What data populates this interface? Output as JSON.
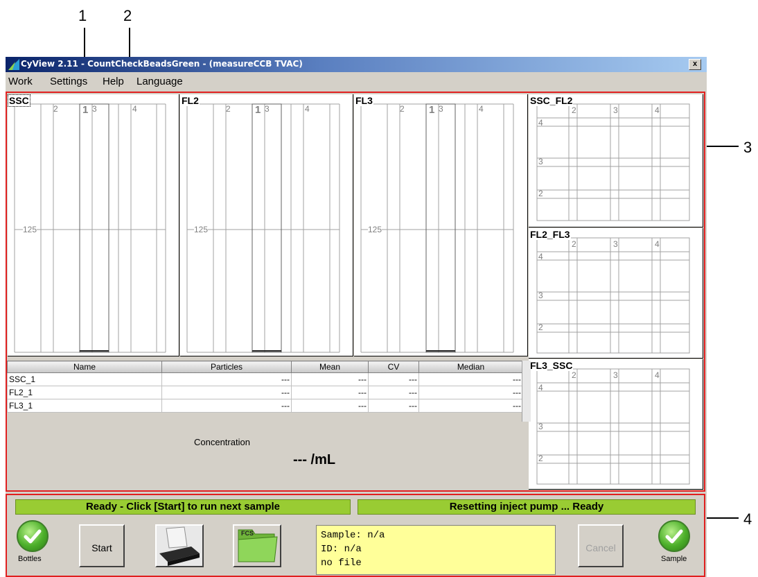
{
  "callouts": [
    "1",
    "2",
    "3",
    "4"
  ],
  "window": {
    "title": "CyView 2.11 - CountCheckBeadsGreen - (measureCCB TVAC)",
    "close_label": "x"
  },
  "menu": [
    {
      "label": "Work"
    },
    {
      "label": "Settings"
    },
    {
      "label": "Help"
    },
    {
      "label": "Language"
    }
  ],
  "histograms": [
    {
      "name": "SSC",
      "marker": "1",
      "ticks": [
        "2",
        "3",
        "4"
      ],
      "y_tick": "125"
    },
    {
      "name": "FL2",
      "marker": "1",
      "ticks": [
        "2",
        "3",
        "4"
      ],
      "y_tick": "125"
    },
    {
      "name": "FL3",
      "marker": "1",
      "ticks": [
        "2",
        "3",
        "4"
      ],
      "y_tick": "125"
    }
  ],
  "scatterplots": [
    {
      "name": "SSC_FL2",
      "x_ticks": [
        "2",
        "3",
        "4"
      ],
      "y_ticks": [
        "4",
        "3",
        "2"
      ]
    },
    {
      "name": "FL2_FL3",
      "x_ticks": [
        "2",
        "3",
        "4"
      ],
      "y_ticks": [
        "4",
        "3",
        "2"
      ]
    },
    {
      "name": "FL3_SSC",
      "x_ticks": [
        "2",
        "3",
        "4"
      ],
      "y_ticks": [
        "4",
        "3",
        "2"
      ]
    }
  ],
  "table": {
    "columns": [
      "Name",
      "Particles",
      "Mean",
      "CV",
      "Median"
    ],
    "rows": [
      [
        "SSC_1",
        "---",
        "---",
        "---",
        "---"
      ],
      [
        "FL2_1",
        "---",
        "---",
        "---",
        "---"
      ],
      [
        "FL3_1",
        "---",
        "---",
        "---",
        "---"
      ]
    ]
  },
  "concentration": {
    "label": "Concentration",
    "value": "--- /mL"
  },
  "status": {
    "left": "Ready - Click [Start] to run next sample",
    "right": "Resetting inject pump ... Ready"
  },
  "controls": {
    "bottles_label": "Bottles",
    "start_label": "Start",
    "cancel_label": "Cancel",
    "sample_label": "Sample",
    "fcs_badge": "FCS"
  },
  "sample_info": {
    "sample": "Sample: n/a",
    "id": "ID: n/a",
    "file": "no file"
  },
  "colors": {
    "highlight_frame": "#e02020",
    "status_bar": "#99cc33",
    "info_box": "#ffff99"
  }
}
